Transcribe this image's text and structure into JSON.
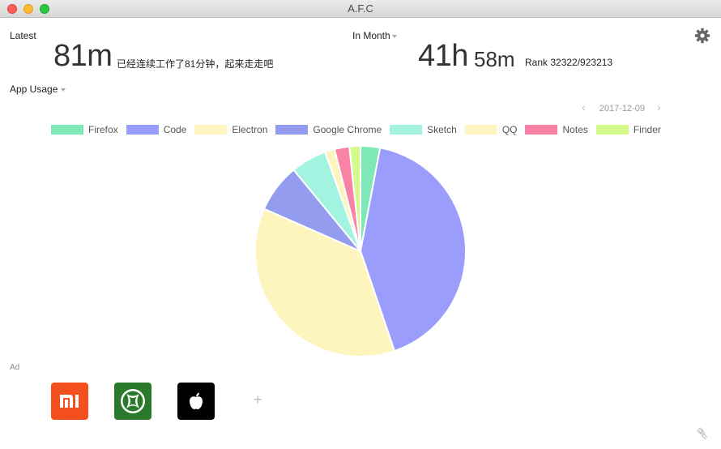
{
  "window": {
    "title": "A.F.C"
  },
  "latest": {
    "label": "Latest",
    "value": "81m",
    "note": "已经连续工作了81分钟，起来走走吧"
  },
  "month": {
    "selector": "In Month",
    "hours": "41h",
    "minutes": "58m",
    "rank": "Rank 32322/923213"
  },
  "usage": {
    "selector": "App Usage",
    "date": "2017-12-09"
  },
  "legend": [
    {
      "name": "Firefox",
      "color": "#7ee8b6"
    },
    {
      "name": "Code",
      "color": "#9b9dfc"
    },
    {
      "name": "Electron",
      "color": "#fdf5bd"
    },
    {
      "name": "Google Chrome",
      "color": "#949cef"
    },
    {
      "name": "Sketch",
      "color": "#a2f4e0"
    },
    {
      "name": "QQ",
      "color": "#fdf5bd"
    },
    {
      "name": "Notes",
      "color": "#f983a7"
    },
    {
      "name": "Finder",
      "color": "#d6f98c"
    }
  ],
  "chart_data": {
    "type": "pie",
    "title": "",
    "slices": [
      {
        "label": "Firefox",
        "value": 3.0,
        "color": "#7ee8b6"
      },
      {
        "label": "Code",
        "value": 42.0,
        "color": "#9b9dfc"
      },
      {
        "label": "Electron",
        "value": 37.0,
        "color": "#fdf5bd"
      },
      {
        "label": "Google Chrome",
        "value": 7.5,
        "color": "#949cef"
      },
      {
        "label": "Sketch",
        "value": 5.5,
        "color": "#a2f4e0"
      },
      {
        "label": "QQ",
        "value": 1.5,
        "color": "#fdf5bd"
      },
      {
        "label": "Notes",
        "value": 2.3,
        "color": "#f983a7"
      },
      {
        "label": "Finder",
        "value": 1.7,
        "color": "#d6f98c"
      }
    ]
  },
  "ad": {
    "label": "Ad",
    "items": [
      {
        "name": "xiaomi-icon",
        "color": "#f4501e"
      },
      {
        "name": "xbox-icon",
        "color": "#2b7a2b"
      },
      {
        "name": "apple-icon",
        "color": "#000000"
      }
    ],
    "add_symbol": "+"
  }
}
